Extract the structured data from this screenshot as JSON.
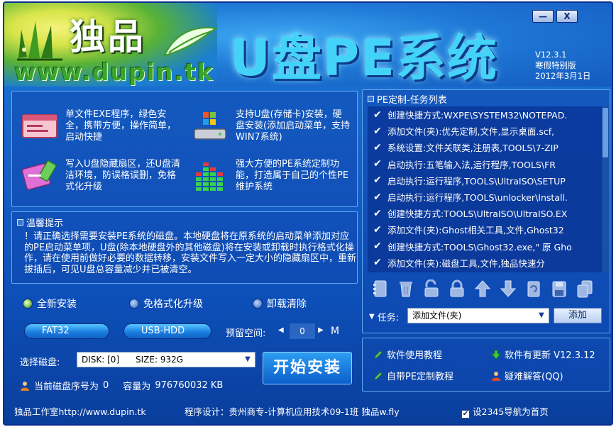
{
  "header": {
    "brand": "独品",
    "brand_url": "www.dupin.tk",
    "title": "U盘PE系统",
    "version": "V12.3.1",
    "edition": "寒假特别版",
    "date": "2012年3月1日"
  },
  "window_buttons": {
    "minimize": "—",
    "close": "X"
  },
  "features": [
    {
      "text": "单文件EXE程序，绿色安全，携带方便，操作简单，启动快捷",
      "icon": "window-icon"
    },
    {
      "text": "支持U盘(存储卡)安装，硬盘安装(添加启动菜单，支持WIN7系统)",
      "icon": "hard-drive-windows-icon"
    },
    {
      "text": "写入U盘隐藏扇区，还U盘清洁环境，防误格误删，免格式化升级",
      "icon": "usb-clean-icon"
    },
    {
      "text": "强大方便的PE系统定制功能，打造属于自己的个性PE维护系统",
      "icon": "equalizer-icon"
    }
  ],
  "tips": {
    "title": "温馨提示",
    "text": "！请正确选择需要安装PE系统的磁盘。本地硬盘将在原系统的启动菜单添加对应的PE启动菜单项，U盘(除本地硬盘外的其他磁盘)将在安装或卸载时执行格式化操作，请在使用前做好必要的数据转移，安装文件写入一定大小的隐藏扇区中，重新拔插后，可见U盘总容量减少并已被清空。"
  },
  "install_modes": [
    {
      "label": "全新安装",
      "selected": true
    },
    {
      "label": "免格式化升级",
      "selected": false
    },
    {
      "label": "卸载清除",
      "selected": false
    }
  ],
  "options": {
    "fs": "FAT32",
    "mode": "USB-HDD",
    "reserve_label": "预留空间:",
    "reserve_value": "0",
    "reserve_unit": "M"
  },
  "disk": {
    "label": "选择磁盘:",
    "selected": "DISK: [0]      SIZE: 932G",
    "current_label": "当前磁盘序号为",
    "current_index": "0",
    "capacity_label": "容量为",
    "capacity_value": "976760032 KB"
  },
  "start_button": "开始安装",
  "pe_panel": {
    "title": "PE定制-任务列表",
    "tasks": [
      "创建快捷方式:WXPE\\SYSTEM32\\NOTEPAD.",
      "添加文件(夹):优先定制,文件,显示桌面.scf,",
      "系统设置:文件关联类,注册表,TOOLS\\7-ZIP",
      "启动执行:五笔输入法,运行程序,TOOLS\\FR",
      "启动执行:运行程序,TOOLS\\UltraISO\\SETUP",
      "启动执行:运行程序,TOOLS\\unlocker\\Install.",
      "创建快捷方式:TOOLS\\UltraISO\\UltraISO.EX",
      "添加文件(夹):Ghost相关工具,文件,Ghost32",
      "创建快捷方式:TOOLS\\Ghost32.exe,\" 原 Gho",
      "添加文件(夹):磁盘工具,文件,独品快速分"
    ],
    "task_label": "任务:",
    "task_selected": "添加文件(夹)",
    "add_button": "添加"
  },
  "links": {
    "tutorial": "软件使用教程",
    "update": "软件有更新 V12.3.12",
    "pe_tutorial": "自带PE定制教程",
    "qa": "疑难解答(QQ)"
  },
  "status": {
    "studio": "独品工作室http://www.dupin.tk",
    "credits": "程序设计：贵州商专-计算机应用技术09-1班 独品w.fly",
    "homepage_checkbox": "设2345导航为首页"
  },
  "colors": {
    "accent": "#1663c9",
    "title_cyan": "#43d3f8",
    "brand_green": "#3aa52d"
  }
}
